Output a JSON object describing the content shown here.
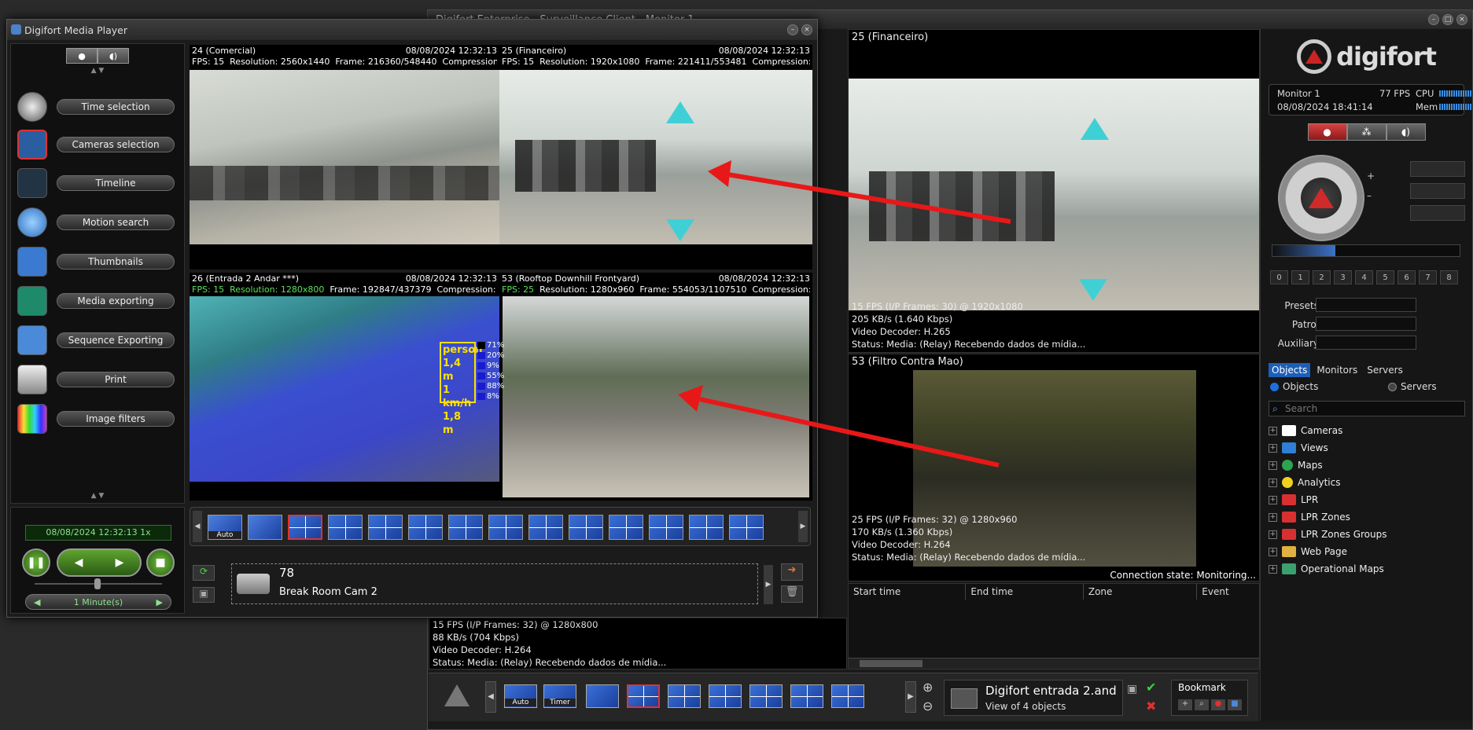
{
  "client": {
    "title": "Digifort Enterprise - Surveillance Client - Monitor 1",
    "pane_financeiro": {
      "title": "25 (Financeiro)",
      "info": [
        "15 FPS (I/P Frames: 30) @ 1920x1080",
        "205 KB/s (1.640 Kbps)",
        "Video Decoder: H.265",
        "Status: Media: (Relay) Recebendo dados de mídia..."
      ]
    },
    "pane_filtro": {
      "title": "53 (Filtro Contra Mao)",
      "info": [
        "25 FPS (I/P Frames: 32) @ 1280x960",
        "170 KB/s (1.360 Kbps)",
        "Video Decoder: H.264",
        "Status: Media: (Relay) Recebendo dados de mídia..."
      ]
    },
    "pane_lower_left": {
      "info": [
        "15 FPS (I/P Frames: 32) @ 1280x800",
        "88 KB/s (704 Kbps)",
        "Video Decoder: H.264",
        "Status: Media: (Relay) Recebendo dados de mídia..."
      ]
    },
    "connection_state": "Connection state: Monitoring...",
    "events_columns": [
      "Start time",
      "End time",
      "Zone",
      "Event"
    ],
    "bottom": {
      "auto_label": "Auto",
      "timer_label": "Timer",
      "view_name": "Digifort entrada 2.and",
      "view_sub": "View of 4 objects",
      "bookmark": "Bookmark"
    }
  },
  "right_panel": {
    "logo": "digifort",
    "monitor": "Monitor 1",
    "fps": "77 FPS",
    "cpu_label": "CPU",
    "datetime": "08/08/2024 18:41:14",
    "mem_label": "Mem",
    "numbers": [
      "0",
      "1",
      "2",
      "3",
      "4",
      "5",
      "6",
      "7",
      "8"
    ],
    "presets_label": "Presets",
    "patrol_label": "Patrol",
    "auxiliary_label": "Auxiliary",
    "tabs": [
      "Objects",
      "Monitors",
      "Servers"
    ],
    "radio_objects": "Objects",
    "radio_servers": "Servers",
    "search_placeholder": "Search",
    "tree": [
      {
        "label": "Cameras",
        "color": "#ffffff"
      },
      {
        "label": "Views",
        "color": "#2f7fd6"
      },
      {
        "label": "Maps",
        "color": "#2ea44f"
      },
      {
        "label": "Analytics",
        "color": "#f0d020"
      },
      {
        "label": "LPR",
        "color": "#d83030"
      },
      {
        "label": "LPR Zones",
        "color": "#d83030"
      },
      {
        "label": "LPR Zones Groups",
        "color": "#d83030"
      },
      {
        "label": "Web Page",
        "color": "#e0b040"
      },
      {
        "label": "Operational Maps",
        "color": "#3aa070"
      }
    ]
  },
  "player": {
    "title": "Digifort Media Player",
    "menu": [
      {
        "label": "Time selection",
        "icon": "stopwatch-icon",
        "color": "#444"
      },
      {
        "label": "Cameras selection",
        "icon": "cameras-icon",
        "color": "#2a5ea0"
      },
      {
        "label": "Timeline",
        "icon": "timeline-icon",
        "color": "#223344"
      },
      {
        "label": "Motion search",
        "icon": "motion-search-icon",
        "color": "#2b6fc0"
      },
      {
        "label": "Thumbnails",
        "icon": "thumbnails-icon",
        "color": "#3a7ad0"
      },
      {
        "label": "Media exporting",
        "icon": "media-export-icon",
        "color": "#1f8a6a"
      },
      {
        "label": "Sequence Exporting",
        "icon": "sequence-export-icon",
        "color": "#4a8ad8"
      },
      {
        "label": "Print",
        "icon": "printer-icon",
        "color": "#888"
      },
      {
        "label": "Image filters",
        "icon": "image-filters-icon",
        "color": "#c050c0"
      }
    ],
    "datetime_display": "08/08/2024 12:32:13 1x",
    "interval": "1 Minute(s)",
    "cams": [
      {
        "name": "24 (Comercial)",
        "time": "08/08/2024 12:32:13",
        "fps": "FPS: 15",
        "res": "Resolution: 2560x1440",
        "frame": "Frame: 216360/548440",
        "comp": "Compression:"
      },
      {
        "name": "25 (Financeiro)",
        "time": "08/08/2024 12:32:13",
        "fps": "FPS: 15",
        "res": "Resolution: 1920x1080",
        "frame": "Frame: 221411/553481",
        "comp": "Compression:"
      },
      {
        "name": "26 (Entrada 2 Andar ***)",
        "time": "08/08/2024 12:32:13",
        "fps": "FPS: 15",
        "res": "Resolution: 1280x800",
        "frame": "Frame: 192847/437379",
        "comp": "Compression: H"
      },
      {
        "name": "53 (Rooftop Downhill Frontyard)",
        "time": "08/08/2024 12:32:13",
        "fps": "FPS: 25",
        "res": "Resolution: 1280x960",
        "frame": "Frame: 554053/1107510",
        "comp": "Compression:"
      }
    ],
    "analytics": {
      "lines": [
        "person",
        "1,4 m",
        "1 km/h",
        "1,8 m"
      ],
      "pct": [
        "71%",
        "20%",
        "9%",
        "55%",
        "88%",
        "8%"
      ]
    },
    "strip_auto": "Auto",
    "cam_number": "78",
    "cam_name": "Break Room Cam 2"
  }
}
